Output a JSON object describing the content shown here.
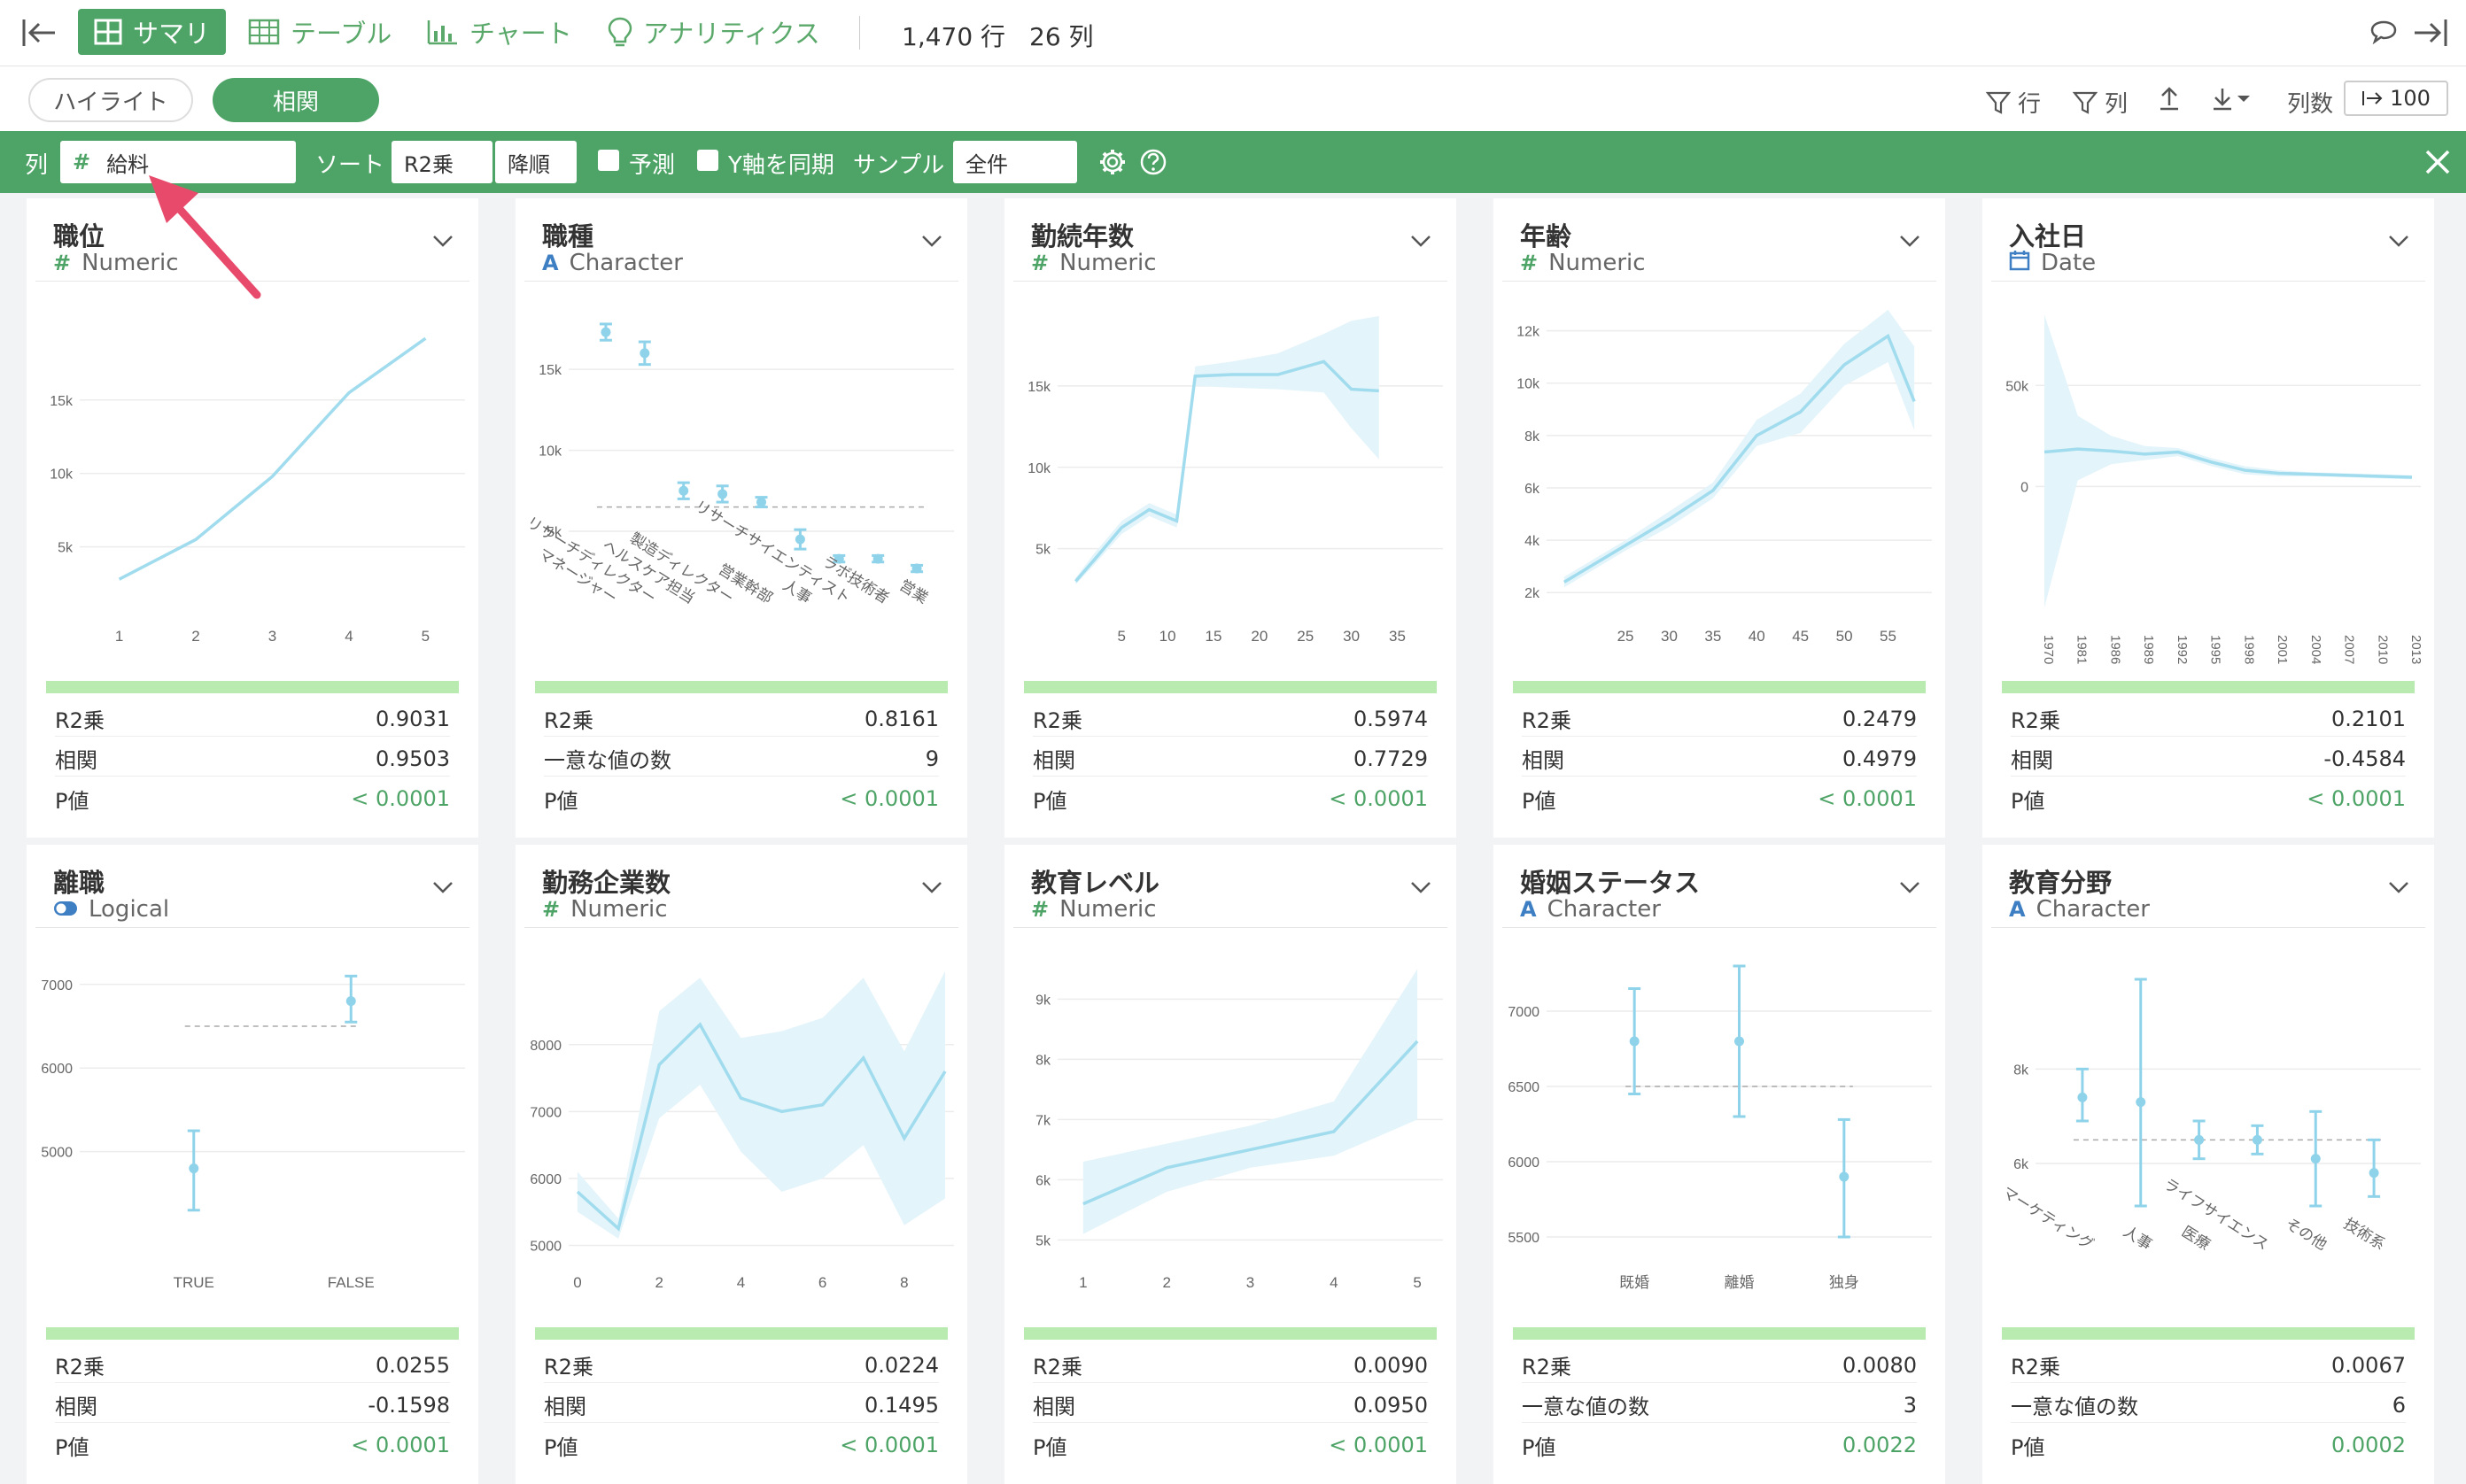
{
  "toolbar": {
    "tabs": [
      {
        "label": "サマリ",
        "icon": "summary-grid-icon"
      },
      {
        "label": "テーブル",
        "icon": "table-icon"
      },
      {
        "label": "チャート",
        "icon": "bar-chart-icon"
      },
      {
        "label": "アナリティクス",
        "icon": "lightbulb-icon"
      }
    ],
    "rows": "1,470 行",
    "cols": "26 列"
  },
  "subbar": {
    "highlight": "ハイライト",
    "correlation": "相関",
    "row_filter": "行",
    "col_filter": "列",
    "col_count_label": "列数",
    "col_count_value": "100"
  },
  "correlation_bar": {
    "col_label": "列",
    "col_value": "給料",
    "sort_label": "ソート",
    "sort_by": "R2乗",
    "sort_order": "降順",
    "predict_label": "予測",
    "sync_y_label": "Y軸を同期",
    "sample_label": "サンプル",
    "sample_value": "全件"
  },
  "colors": {
    "accent": "#4ea467",
    "line": "#a0dcee",
    "band": "#e3f4fa",
    "summary_bar": "#b9eab0"
  },
  "cards": [
    {
      "title": "職位",
      "type": "Numeric",
      "type_icon": "#",
      "stats": [
        {
          "label": "R2乗",
          "value": "0.9031"
        },
        {
          "label": "相関",
          "value": "0.9503"
        },
        {
          "label": "P値",
          "value": "< 0.0001",
          "green": true
        }
      ],
      "chart_data": {
        "type": "line",
        "x": [
          1,
          2,
          3,
          4,
          5
        ],
        "y": [
          2800,
          5500,
          9800,
          15500,
          19200
        ],
        "xticks": [
          "1",
          "2",
          "3",
          "4",
          "5"
        ],
        "yticks": [
          {
            "v": 5000,
            "l": "5k"
          },
          {
            "v": 10000,
            "l": "10k"
          },
          {
            "v": 15000,
            "l": "15k"
          }
        ],
        "xlim": [
          0.6,
          5.4
        ],
        "ylim": [
          1000,
          21500
        ]
      }
    },
    {
      "title": "職種",
      "type": "Character",
      "type_icon": "A",
      "stats": [
        {
          "label": "R2乗",
          "value": "0.8161"
        },
        {
          "label": "一意な値の数",
          "value": "9"
        },
        {
          "label": "P値",
          "value": "< 0.0001",
          "green": true
        }
      ],
      "chart_data": {
        "type": "errorbar",
        "categories": [
          "マネージャー",
          "リサーチディレクター",
          "ヘルスケア担当",
          "製造ディレクター",
          "営業幹部",
          "人事",
          "リサーチサイエンティスト",
          "ラボ技術者",
          "営業"
        ],
        "y": [
          17300,
          16000,
          7500,
          7300,
          6800,
          4500,
          3300,
          3300,
          2700
        ],
        "lo": [
          16800,
          15300,
          7000,
          6800,
          6500,
          3900,
          3100,
          3100,
          2500
        ],
        "hi": [
          17800,
          16700,
          8000,
          7800,
          7100,
          5100,
          3500,
          3500,
          2900
        ],
        "mean": 6500,
        "yticks": [
          {
            "v": 5000,
            "l": "5k"
          },
          {
            "v": 10000,
            "l": "10k"
          },
          {
            "v": 15000,
            "l": "15k"
          }
        ],
        "ylim": [
          1500,
          19000
        ]
      }
    },
    {
      "title": "勤続年数",
      "type": "Numeric",
      "type_icon": "#",
      "stats": [
        {
          "label": "R2乗",
          "value": "0.5974"
        },
        {
          "label": "相関",
          "value": "0.7729"
        },
        {
          "label": "P値",
          "value": "< 0.0001",
          "green": true
        }
      ],
      "chart_data": {
        "type": "line",
        "x": [
          0,
          2,
          5,
          8,
          11,
          13,
          17,
          22,
          27,
          30,
          33
        ],
        "y": [
          3000,
          4300,
          6300,
          7400,
          6700,
          15600,
          15700,
          15700,
          16500,
          14800,
          14700
        ],
        "lo": [
          2800,
          4000,
          5900,
          7000,
          6300,
          15000,
          14900,
          14800,
          14600,
          12400,
          10500
        ],
        "hi": [
          3200,
          4700,
          6700,
          7800,
          7100,
          16200,
          16500,
          17000,
          18200,
          19000,
          19300
        ],
        "xticks": [
          "5",
          "10",
          "15",
          "20",
          "25",
          "30",
          "35"
        ],
        "xtickv": [
          5,
          10,
          15,
          20,
          25,
          30,
          35
        ],
        "yticks": [
          {
            "v": 5000,
            "l": "5k"
          },
          {
            "v": 10000,
            "l": "10k"
          },
          {
            "v": 15000,
            "l": "15k"
          }
        ],
        "xlim": [
          -1,
          39
        ],
        "ylim": [
          1500,
          20000
        ]
      }
    },
    {
      "title": "年齢",
      "type": "Numeric",
      "type_icon": "#",
      "stats": [
        {
          "label": "R2乗",
          "value": "0.2479"
        },
        {
          "label": "相関",
          "value": "0.4979"
        },
        {
          "label": "P値",
          "value": "< 0.0001",
          "green": true
        }
      ],
      "chart_data": {
        "type": "line",
        "x": [
          18,
          25,
          30,
          35,
          40,
          45,
          50,
          55,
          58
        ],
        "y": [
          2400,
          3800,
          4800,
          5900,
          8000,
          8900,
          10700,
          11800,
          9300
        ],
        "lo": [
          2200,
          3600,
          4500,
          5600,
          7600,
          8100,
          9900,
          10800,
          8200
        ],
        "hi": [
          2600,
          4000,
          5100,
          6200,
          8600,
          9600,
          11500,
          12800,
          11400
        ],
        "xticks": [
          "25",
          "30",
          "35",
          "40",
          "45",
          "50",
          "55"
        ],
        "xtickv": [
          25,
          30,
          35,
          40,
          45,
          50,
          55
        ],
        "yticks": [
          {
            "v": 2000,
            "l": "2k"
          },
          {
            "v": 4000,
            "l": "4k"
          },
          {
            "v": 6000,
            "l": "6k"
          },
          {
            "v": 8000,
            "l": "8k"
          },
          {
            "v": 10000,
            "l": "10k"
          },
          {
            "v": 12000,
            "l": "12k"
          }
        ],
        "xlim": [
          17,
          59
        ],
        "ylim": [
          1500,
          13000
        ]
      }
    },
    {
      "title": "入社日",
      "type": "Date",
      "type_icon": "cal",
      "stats": [
        {
          "label": "R2乗",
          "value": "0.2101"
        },
        {
          "label": "相関",
          "value": "-0.4584"
        },
        {
          "label": "P値",
          "value": "< 0.0001",
          "green": true
        }
      ],
      "chart_data": {
        "type": "line",
        "x": [
          0,
          2,
          4,
          6,
          8,
          10,
          12,
          14,
          16,
          18,
          20,
          22
        ],
        "y": [
          17000,
          18500,
          17500,
          16000,
          17000,
          12000,
          8000,
          6500,
          6000,
          5500,
          5000,
          4500
        ],
        "lo": [
          -60000,
          3000,
          11000,
          13000,
          15000,
          10000,
          6000,
          5000,
          5000,
          4500,
          4000,
          3500
        ],
        "hi": [
          85000,
          35000,
          25000,
          20000,
          19000,
          14000,
          10000,
          8000,
          7000,
          6500,
          6000,
          5500
        ],
        "xticks": [
          "1970",
          "1981",
          "1986",
          "1989",
          "1992",
          "1995",
          "1998",
          "2001",
          "2004",
          "2007",
          "2010",
          "2013"
        ],
        "yticks": [
          {
            "v": 0,
            "l": "0"
          },
          {
            "v": 50000,
            "l": "50k"
          }
        ],
        "xlim": [
          0,
          22
        ],
        "ylim": [
          -70000,
          90000
        ]
      }
    },
    {
      "title": "離職",
      "type": "Logical",
      "type_icon": "toggle",
      "stats": [
        {
          "label": "R2乗",
          "value": "0.0255"
        },
        {
          "label": "相関",
          "value": "-0.1598"
        },
        {
          "label": "P値",
          "value": "< 0.0001",
          "green": true
        }
      ],
      "chart_data": {
        "type": "errorbar",
        "categories": [
          "TRUE",
          "FALSE"
        ],
        "y": [
          4800,
          6800
        ],
        "lo": [
          4300,
          6550
        ],
        "hi": [
          5250,
          7100
        ],
        "mean": 6500,
        "yticks": [
          {
            "v": 5000,
            "l": "5000"
          },
          {
            "v": 6000,
            "l": "6000"
          },
          {
            "v": 7000,
            "l": "7000"
          }
        ],
        "ylim": [
          3800,
          7400
        ]
      }
    },
    {
      "title": "勤務企業数",
      "type": "Numeric",
      "type_icon": "#",
      "stats": [
        {
          "label": "R2乗",
          "value": "0.0224"
        },
        {
          "label": "相関",
          "value": "0.1495"
        },
        {
          "label": "P値",
          "value": "< 0.0001",
          "green": true
        }
      ],
      "chart_data": {
        "type": "line",
        "x": [
          0,
          1,
          2,
          3,
          4,
          5,
          6,
          7,
          8,
          9
        ],
        "y": [
          5800,
          5250,
          7700,
          8300,
          7200,
          7000,
          7100,
          7800,
          6600,
          7600
        ],
        "lo": [
          5500,
          5100,
          6900,
          7400,
          6400,
          5800,
          6000,
          6500,
          5300,
          5700
        ],
        "hi": [
          6100,
          5400,
          8500,
          9000,
          8100,
          8200,
          8400,
          9000,
          7900,
          9100
        ],
        "xticks": [
          "0",
          "2",
          "4",
          "6",
          "8"
        ],
        "xtickv": [
          0,
          2,
          4,
          6,
          8
        ],
        "yticks": [
          {
            "v": 5000,
            "l": "5000"
          },
          {
            "v": 6000,
            "l": "6000"
          },
          {
            "v": 7000,
            "l": "7000"
          },
          {
            "v": 8000,
            "l": "8000"
          }
        ],
        "xlim": [
          0,
          9
        ],
        "ylim": [
          4900,
          9400
        ]
      }
    },
    {
      "title": "教育レベル",
      "type": "Numeric",
      "type_icon": "#",
      "stats": [
        {
          "label": "R2乗",
          "value": "0.0090"
        },
        {
          "label": "相関",
          "value": "0.0950"
        },
        {
          "label": "P値",
          "value": "< 0.0001",
          "green": true
        }
      ],
      "chart_data": {
        "type": "line",
        "x": [
          1,
          2,
          3,
          4,
          5
        ],
        "y": [
          5600,
          6200,
          6500,
          6800,
          8300
        ],
        "lo": [
          5100,
          5800,
          6200,
          6400,
          7000
        ],
        "hi": [
          6300,
          6600,
          6900,
          7300,
          9500
        ],
        "xticks": [
          "1",
          "2",
          "3",
          "4",
          "5"
        ],
        "xtickv": [
          1,
          2,
          3,
          4,
          5
        ],
        "yticks": [
          {
            "v": 5000,
            "l": "5k"
          },
          {
            "v": 6000,
            "l": "6k"
          },
          {
            "v": 7000,
            "l": "7k"
          },
          {
            "v": 8000,
            "l": "8k"
          },
          {
            "v": 9000,
            "l": "9k"
          }
        ],
        "xlim": [
          0.8,
          5.2
        ],
        "ylim": [
          4800,
          9800
        ]
      }
    },
    {
      "title": "婚姻ステータス",
      "type": "Character",
      "type_icon": "A",
      "stats": [
        {
          "label": "R2乗",
          "value": "0.0080"
        },
        {
          "label": "一意な値の数",
          "value": "3"
        },
        {
          "label": "P値",
          "value": "0.0022",
          "green": true
        }
      ],
      "chart_data": {
        "type": "errorbar",
        "categories": [
          "既婚",
          "離婚",
          "独身"
        ],
        "y": [
          6800,
          6800,
          5900
        ],
        "lo": [
          6450,
          6300,
          5500
        ],
        "hi": [
          7150,
          7300,
          6280
        ],
        "mean": 6500,
        "yticks": [
          {
            "v": 5500,
            "l": "5500"
          },
          {
            "v": 6000,
            "l": "6000"
          },
          {
            "v": 6500,
            "l": "6500"
          },
          {
            "v": 7000,
            "l": "7000"
          }
        ],
        "ylim": [
          5400,
          7400
        ]
      }
    },
    {
      "title": "教育分野",
      "type": "Character",
      "type_icon": "A",
      "stats": [
        {
          "label": "R2乗",
          "value": "0.0067"
        },
        {
          "label": "一意な値の数",
          "value": "6"
        },
        {
          "label": "P値",
          "value": "0.0002",
          "green": true
        }
      ],
      "chart_data": {
        "type": "errorbar",
        "categories": [
          "マーケティング",
          "人事",
          "医療",
          "ライフサイエンス",
          "その他",
          "技術系"
        ],
        "y": [
          7400,
          7300,
          6500,
          6500,
          6100,
          5800
        ],
        "lo": [
          6900,
          5100,
          6100,
          6200,
          5100,
          5300
        ],
        "hi": [
          8000,
          9900,
          6900,
          6800,
          7100,
          6500
        ],
        "mean": 6500,
        "yticks": [
          {
            "v": 6000,
            "l": "6k"
          },
          {
            "v": 8000,
            "l": "8k"
          }
        ],
        "ylim": [
          4500,
          10500
        ]
      }
    }
  ]
}
